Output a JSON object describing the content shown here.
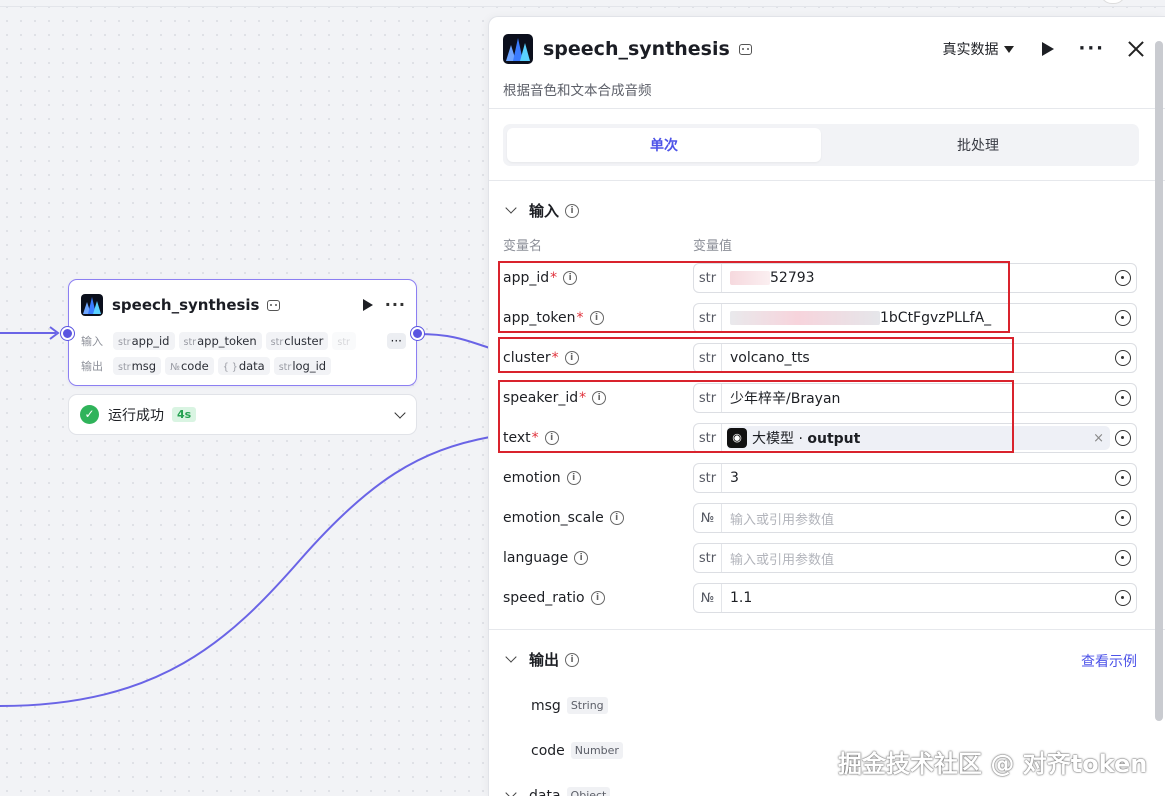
{
  "node": {
    "title": "speech_synthesis",
    "input_label": "输入",
    "output_label": "输出",
    "inputs": [
      {
        "type": "str",
        "name": "app_id"
      },
      {
        "type": "str",
        "name": "app_token"
      },
      {
        "type": "str",
        "name": "cluster"
      },
      {
        "type": "str",
        "name": ""
      }
    ],
    "more_label": "···",
    "outputs": [
      {
        "type": "str",
        "name": "msg"
      },
      {
        "type": "№",
        "name": "code"
      },
      {
        "type": "{ }",
        "name": "data"
      },
      {
        "type": "str",
        "name": "log_id"
      }
    ],
    "status_text": "运行成功",
    "status_time": "4s",
    "status_icon": "check-circle-icon"
  },
  "panel": {
    "title": "speech_synthesis",
    "description": "根据音色和文本合成音频",
    "data_mode": "真实数据",
    "tabs": [
      {
        "label": "单次",
        "active": true
      },
      {
        "label": "批处理",
        "active": false
      }
    ],
    "input_section": "输入",
    "col_name": "变量名",
    "col_value": "变量值",
    "params": [
      {
        "name": "app_id",
        "required": true,
        "type": "str",
        "value": "52793",
        "masked": true
      },
      {
        "name": "app_token",
        "required": true,
        "type": "str",
        "value": "1bCtFgvzPLLfA_",
        "masked": true
      },
      {
        "name": "cluster",
        "required": true,
        "type": "str",
        "value": "volcano_tts"
      },
      {
        "name": "speaker_id",
        "required": true,
        "type": "str",
        "value": "少年梓辛/Brayan"
      },
      {
        "name": "text",
        "required": true,
        "type": "str",
        "ref_node": "大模型",
        "ref_sep": " · ",
        "ref_field": "output",
        "ref_clear": "×"
      },
      {
        "name": "emotion",
        "required": false,
        "type": "str",
        "value": "3"
      },
      {
        "name": "emotion_scale",
        "required": false,
        "type": "№",
        "placeholder": "输入或引用参数值"
      },
      {
        "name": "language",
        "required": false,
        "type": "str",
        "placeholder": "输入或引用参数值"
      },
      {
        "name": "speed_ratio",
        "required": false,
        "type": "№",
        "value": "1.1"
      }
    ],
    "output_section": "输出",
    "view_example": "查看示例",
    "outputs": [
      {
        "name": "msg",
        "type": "String"
      },
      {
        "name": "code",
        "type": "Number"
      },
      {
        "name": "data",
        "type": "Object"
      }
    ]
  },
  "watermark": "掘金技术社区 @ 对齐token",
  "colors": {
    "accent": "#4d53e8",
    "wire": "#6a64e6",
    "highlight": "#d9232d",
    "success": "#2fb35a"
  }
}
